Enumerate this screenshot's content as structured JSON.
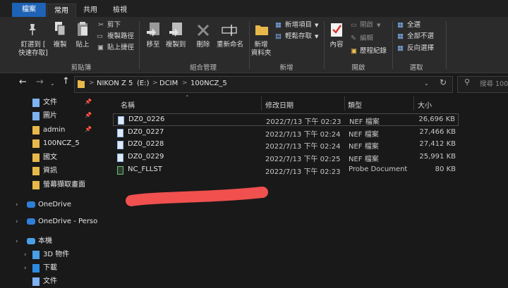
{
  "tabs": {
    "file": "檔案",
    "home": "常用",
    "share": "共用",
    "view": "檢視"
  },
  "ribbon": {
    "clipboard": {
      "pin": "釘選到 [",
      "pin2": "快速存取]",
      "copy": "複製",
      "paste": "貼上",
      "cut": "剪下",
      "copy_path": "複製路徑",
      "paste_shortcut": "貼上捷徑",
      "group": "剪貼簿"
    },
    "organize": {
      "move": "移至",
      "copy_to": "複製到",
      "delete": "刪除",
      "rename": "重新命名",
      "group": "組合管理"
    },
    "new": {
      "folder1": "新增",
      "folder2": "資料夾",
      "new_item": "新增項目",
      "easy_access": "輕鬆存取",
      "group": "新增"
    },
    "open": {
      "properties": "內容",
      "open": "開啟",
      "edit": "編輯",
      "history": "歷程紀錄",
      "group": "開啟"
    },
    "select": {
      "all": "全選",
      "none": "全部不選",
      "invert": "反向選擇",
      "group": "選取"
    }
  },
  "address": {
    "crumbs": [
      "NIKON Z 5",
      "(E:)",
      "DCIM",
      "100NCZ_5"
    ],
    "search_placeholder": "搜尋 100"
  },
  "columns": {
    "name": "名稱",
    "modified": "修改日期",
    "type": "類型",
    "size": "大小"
  },
  "files": [
    {
      "name": "DZ0_0226",
      "date": "2022/7/13 下午 02:23",
      "type": "NEF 檔案",
      "size": "26,696 KB"
    },
    {
      "name": "DZ0_0227",
      "date": "2022/7/13 下午 02:24",
      "type": "NEF 檔案",
      "size": "27,466 KB"
    },
    {
      "name": "DZ0_0228",
      "date": "2022/7/13 下午 02:24",
      "type": "NEF 檔案",
      "size": "27,412 KB"
    },
    {
      "name": "DZ0_0229",
      "date": "2022/7/13 下午 02:25",
      "type": "NEF 檔案",
      "size": "25,991 KB"
    },
    {
      "name": "NC_FLLST",
      "date": "2022/7/13 下午 02:23",
      "type": "Probe Document",
      "size": "80 KB"
    }
  ],
  "nav": {
    "quick": [
      "文件",
      "圖片",
      "admin",
      "100NCZ_5",
      "國文",
      "資訊",
      "螢幕擷取畫面"
    ],
    "onedrive": "OneDrive",
    "onedrive_personal": "OneDrive - Perso",
    "thispc": "本機",
    "pc_items": [
      "3D 物件",
      "下載",
      "文件"
    ]
  },
  "colors": {
    "accent": "#1e63b6",
    "bg": "#191919",
    "ribbon": "#2b2b2b",
    "redact": "#f0504e"
  }
}
